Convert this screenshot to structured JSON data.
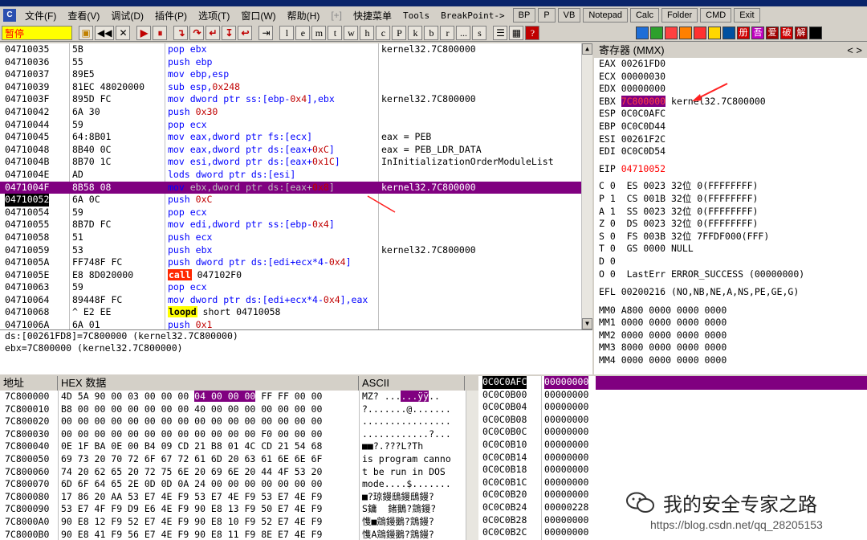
{
  "menu": {
    "items": [
      "文件(F)",
      "查看(V)",
      "调试(D)",
      "插件(P)",
      "选项(T)",
      "窗口(W)",
      "帮助(H)",
      "[+]",
      "快捷菜单",
      "Tools",
      "BreakPoint->"
    ],
    "right_buttons": [
      "BP",
      "P",
      "VB",
      "Notepad",
      "Calc",
      "Folder",
      "CMD",
      "Exit"
    ]
  },
  "toolbar": {
    "status": "暂停",
    "nav_buttons": [
      "⏮",
      "◀◀",
      "✕",
      "▶",
      "⏸"
    ],
    "step_buttons": [
      "↴",
      "↷",
      "↵",
      "↧",
      "↩",
      "⇥"
    ],
    "letters": [
      "l",
      "e",
      "m",
      "t",
      "w",
      "h",
      "c",
      "P",
      "k",
      "b",
      "r",
      "...",
      "s"
    ],
    "colors": [
      "#1e6ed8",
      "#2ca02c",
      "#ff4040",
      "#ff8000",
      "#ff3030",
      "#ffd700",
      "#0050a0",
      "#d00000",
      "#c000c0",
      "#a00000",
      "#000000"
    ],
    "right_label_icons": [
      "册",
      "吾",
      "爱",
      "破",
      "解"
    ]
  },
  "cpu": {
    "rows": [
      {
        "addr": "04710035",
        "hex": "5B",
        "asm": "pop ebx",
        "cmt": "kernel32.7C800000",
        "cls": ""
      },
      {
        "addr": "04710036",
        "hex": "55",
        "asm": "push ebp",
        "cmt": "",
        "cls": ""
      },
      {
        "addr": "04710037",
        "hex": "89E5",
        "asm": "mov ebp,esp",
        "cmt": "",
        "cls": ""
      },
      {
        "addr": "04710039",
        "hex": "81EC 48020000",
        "asm": "sub esp,0x248",
        "cmt": "",
        "cls": ""
      },
      {
        "addr": "0471003F",
        "hex": "895D FC",
        "asm": "mov dword ptr ss:[ebp-0x4],ebx",
        "cmt": "kernel32.7C800000",
        "cls": ""
      },
      {
        "addr": "04710042",
        "hex": "6A 30",
        "asm": "push 0x30",
        "cmt": "",
        "cls": ""
      },
      {
        "addr": "04710044",
        "hex": "59",
        "asm": "pop ecx",
        "cmt": "",
        "cls": ""
      },
      {
        "addr": "04710045",
        "hex": "64:8B01",
        "asm": "mov eax,dword ptr fs:[ecx]",
        "cmt": "eax = PEB",
        "cls": ""
      },
      {
        "addr": "04710048",
        "hex": "8B40 0C",
        "asm": "mov eax,dword ptr ds:[eax+0xC]",
        "cmt": "eax = PEB_LDR_DATA",
        "cls": ""
      },
      {
        "addr": "0471004B",
        "hex": "8B70 1C",
        "asm": "mov esi,dword ptr ds:[eax+0x1C]",
        "cmt": "InInitializationOrderModuleList",
        "cls": ""
      },
      {
        "addr": "0471004E",
        "hex": "AD",
        "asm": "lods dword ptr ds:[esi]",
        "cmt": "",
        "cls": ""
      },
      {
        "addr": "0471004F",
        "hex": "8B58 08",
        "asm": "mov ebx,dword ptr ds:[eax+0x8]",
        "cmt": "kernel32.7C800000",
        "cls": "sel"
      },
      {
        "addr": "04710052",
        "hex": "6A 0C",
        "asm": "push 0xC",
        "cmt": "",
        "cls": "eip"
      },
      {
        "addr": "04710054",
        "hex": "59",
        "asm": "pop ecx",
        "cmt": "",
        "cls": ""
      },
      {
        "addr": "04710055",
        "hex": "8B7D FC",
        "asm": "mov edi,dword ptr ss:[ebp-0x4]",
        "cmt": "",
        "cls": ""
      },
      {
        "addr": "04710058",
        "hex": "51",
        "asm": "push ecx",
        "cmt": "",
        "cls": ""
      },
      {
        "addr": "04710059",
        "hex": "53",
        "asm": "push ebx",
        "cmt": "kernel32.7C800000",
        "cls": ""
      },
      {
        "addr": "0471005A",
        "hex": "FF748F FC",
        "asm": "push dword ptr ds:[edi+ecx*4-0x4]",
        "cmt": "",
        "cls": ""
      },
      {
        "addr": "0471005E",
        "hex": "E8 8D020000",
        "asm": "call 047102F0",
        "cmt": "",
        "cls": "call"
      },
      {
        "addr": "04710063",
        "hex": "59",
        "asm": "pop ecx",
        "cmt": "",
        "cls": ""
      },
      {
        "addr": "04710064",
        "hex": "89448F FC",
        "asm": "mov dword ptr ds:[edi+ecx*4-0x4],eax",
        "cmt": "",
        "cls": ""
      },
      {
        "addr": "04710068",
        "hex": "^ E2 EE",
        "asm": "loopd short 04710058",
        "cmt": "",
        "cls": "loop"
      },
      {
        "addr": "0471006A",
        "hex": "6A 01",
        "asm": "push 0x1",
        "cmt": "",
        "cls": ""
      }
    ]
  },
  "info": {
    "line1": "ds:[00261FD8]=7C800000 (kernel32.7C800000)",
    "line2": "ebx=7C800000 (kernel32.7C800000)"
  },
  "registers": {
    "title": "寄存器 (MMX)",
    "nav": "<  >",
    "eax": "EAX 00261FD0",
    "ecx": "ECX 00000030",
    "edx": "EDX 00000000",
    "ebx_label": "EBX ",
    "ebx_value": "7C800000",
    "ebx_comment": " kernel32.7C800000",
    "esp": "ESP 0C0C0AFC",
    "ebp": "EBP 0C0C0D44",
    "esi": "ESI 00261F2C",
    "edi": "EDI 0C0C0D54",
    "eip_label": "EIP ",
    "eip_value": "04710052",
    "flags": [
      "C 0  ES 0023 32位 0(FFFFFFFF)",
      "P 1  CS 001B 32位 0(FFFFFFFF)",
      "A 1  SS 0023 32位 0(FFFFFFFF)",
      "Z 0  DS 0023 32位 0(FFFFFFFF)",
      "S 0  FS 003B 32位 7FFDF000(FFF)",
      "T 0  GS 0000 NULL",
      "D 0",
      "O 0  LastErr ERROR_SUCCESS (00000000)"
    ],
    "efl": "EFL 00200216 (NO,NB,NE,A,NS,PE,GE,G)",
    "mm": [
      "MM0 A800 0000 0000 0000",
      "MM1 0000 0000 0000 0000",
      "MM2 0000 0000 0000 0000",
      "MM3 8000 0000 0000 0000",
      "MM4 0000 0000 0000 0000"
    ]
  },
  "dump": {
    "headers": [
      "地址",
      "HEX 数据",
      "ASCII"
    ],
    "rows": [
      {
        "addr": "7C800000",
        "hexA": "4D 5A 90 00 03 00 00 00 ",
        "hexB": "04 00 00 00",
        "hexC": " FF FF 00 00",
        "ascii": "MZ? ...",
        "asciiHl": "...ÿÿ",
        "asciiC": ".."
      },
      {
        "addr": "7C800010",
        "hexA": "B8 00 00 00 00 00 00 00 40 00 00 00 00 00 00 00",
        "hexB": "",
        "hexC": "",
        "ascii": "?.......@.......",
        "asciiHl": "",
        "asciiC": ""
      },
      {
        "addr": "7C800020",
        "hexA": "00 00 00 00 00 00 00 00 00 00 00 00 00 00 00 00",
        "hexB": "",
        "hexC": "",
        "ascii": "................",
        "asciiHl": "",
        "asciiC": ""
      },
      {
        "addr": "7C800030",
        "hexA": "00 00 00 00 00 00 00 00 00 00 00 00 F0 00 00 00",
        "hexB": "",
        "hexC": "",
        "ascii": "............?...",
        "asciiHl": "",
        "asciiC": ""
      },
      {
        "addr": "7C800040",
        "hexA": "0E 1F BA 0E 00 B4 09 CD 21 B8 01 4C CD 21 54 68",
        "hexB": "",
        "hexC": "",
        "ascii": "■■?.???L?Th",
        "asciiHl": "",
        "asciiC": ""
      },
      {
        "addr": "7C800050",
        "hexA": "69 73 20 70 72 6F 67 72 61 6D 20 63 61 6E 6E 6F",
        "hexB": "",
        "hexC": "",
        "ascii": "is program canno",
        "asciiHl": "",
        "asciiC": ""
      },
      {
        "addr": "7C800060",
        "hexA": "74 20 62 65 20 72 75 6E 20 69 6E 20 44 4F 53 20",
        "hexB": "",
        "hexC": "",
        "ascii": "t be run in DOS ",
        "asciiHl": "",
        "asciiC": ""
      },
      {
        "addr": "7C800070",
        "hexA": "6D 6F 64 65 2E 0D 0D 0A 24 00 00 00 00 00 00 00",
        "hexB": "",
        "hexC": "",
        "ascii": "mode....$.......",
        "asciiHl": "",
        "asciiC": ""
      },
      {
        "addr": "7C800080",
        "hexA": "17 86 20 AA 53 E7 4E F9 53 E7 4E F9 53 E7 4E F9",
        "hexB": "",
        "hexC": "",
        "ascii": "■?琼鏝鴟鏝鴟鏝?",
        "asciiHl": "",
        "asciiC": ""
      },
      {
        "addr": "7C800090",
        "hexA": "53 E7 4F F9 D9 E6 4E F9 90 E8 13 F9 50 E7 4E F9",
        "hexB": "",
        "hexC": "",
        "ascii": "S鏞  鍺鵝?鵍鏝?",
        "asciiHl": "",
        "asciiC": ""
      },
      {
        "addr": "7C8000A0",
        "hexA": "90 E8 12 F9 52 E7 4E F9 90 E8 10 F9 52 E7 4E F9",
        "hexB": "",
        "hexC": "",
        "ascii": "愯■鵍鏝鵝?鵍鏝?",
        "asciiHl": "",
        "asciiC": ""
      },
      {
        "addr": "7C8000B0",
        "hexA": "90 E8 41 F9 56 E7 4E F9 90 E8 11 F9 8E E7 4E F9",
        "hexB": "",
        "hexC": "",
        "ascii": "愯A鵍鏝鵝?鵍鏝?",
        "asciiHl": "",
        "asciiC": ""
      }
    ]
  },
  "stack": {
    "rows": [
      {
        "addr": "0C0C0AFC",
        "val": "00000000",
        "top": true
      },
      {
        "addr": "0C0C0B00",
        "val": "00000000",
        "top": false
      },
      {
        "addr": "0C0C0B04",
        "val": "00000000",
        "top": false
      },
      {
        "addr": "0C0C0B08",
        "val": "00000000",
        "top": false
      },
      {
        "addr": "0C0C0B0C",
        "val": "00000000",
        "top": false
      },
      {
        "addr": "0C0C0B10",
        "val": "00000000",
        "top": false
      },
      {
        "addr": "0C0C0B14",
        "val": "00000000",
        "top": false
      },
      {
        "addr": "0C0C0B18",
        "val": "00000000",
        "top": false
      },
      {
        "addr": "0C0C0B1C",
        "val": "00000000",
        "top": false
      },
      {
        "addr": "0C0C0B20",
        "val": "00000000",
        "top": false
      },
      {
        "addr": "0C0C0B24",
        "val": "00000228",
        "top": false
      },
      {
        "addr": "0C0C0B28",
        "val": "00000000",
        "top": false
      },
      {
        "addr": "0C0C0B2C",
        "val": "00000000",
        "top": false
      }
    ]
  },
  "watermark": {
    "text": "我的安全专家之路",
    "url": "https://blog.csdn.net/qq_28205153"
  }
}
